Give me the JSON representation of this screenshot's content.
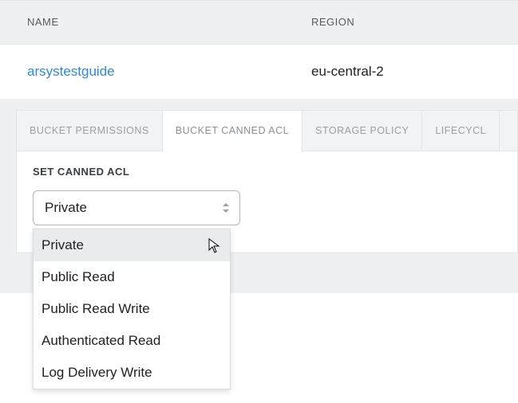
{
  "columns": {
    "name": "NAME",
    "region": "REGION"
  },
  "row": {
    "bucket_name": "arsystestguide",
    "region": "eu-central-2"
  },
  "tabs": [
    {
      "label": "BUCKET PERMISSIONS",
      "active": false
    },
    {
      "label": "BUCKET CANNED ACL",
      "active": true
    },
    {
      "label": "STORAGE POLICY",
      "active": false
    },
    {
      "label": "LIFECYCL",
      "active": false
    }
  ],
  "form": {
    "label": "SET CANNED ACL",
    "selected": "Private",
    "options": [
      "Private",
      "Public Read",
      "Public Read Write",
      "Authenticated Read",
      "Log Delivery Write"
    ]
  }
}
